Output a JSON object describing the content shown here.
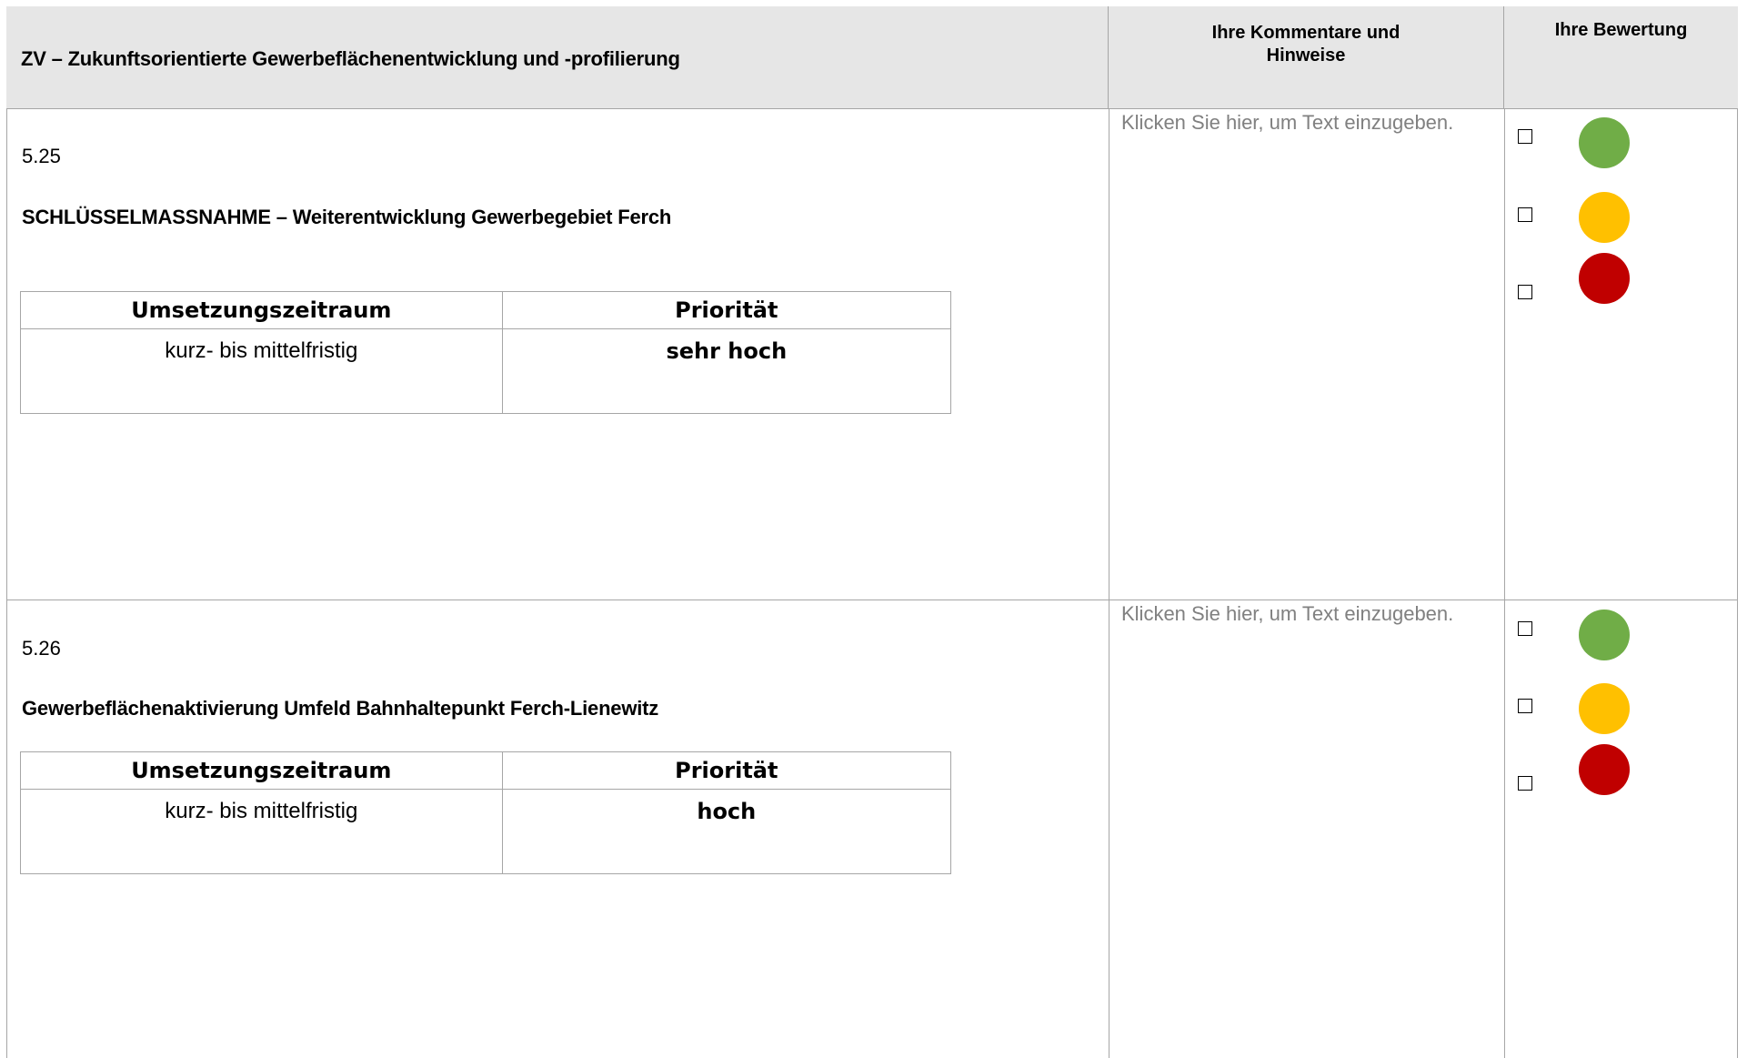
{
  "header": {
    "title": "ZV – Zukunftsorientierte Gewerbeflächenentwicklung und -profilierung",
    "comments_line1": "Ihre Kommentare und",
    "comments_line2": "Hinweise",
    "rating": "Ihre Bewertung"
  },
  "measures": [
    {
      "number": "5.25",
      "title": "SCHLÜSSELMASSNAHME – Weiterentwicklung Gewerbegebiet Ferch",
      "table_header": [
        "Umsetzungszeitraum",
        "Priorität"
      ],
      "timeframe": "kurz- bis mittelfristig",
      "priority": "sehr hoch",
      "comment_placeholder": "Klicken Sie hier, um Text einzugeben.",
      "rating_options": [
        {
          "color_name": "green",
          "color": "#70ad47",
          "checked": false
        },
        {
          "color_name": "yellow",
          "color": "#ffc000",
          "checked": false
        },
        {
          "color_name": "red",
          "color": "#c00000",
          "checked": false
        }
      ]
    },
    {
      "number": "5.26",
      "title": "Gewerbeflächenaktivierung Umfeld Bahnhaltepunkt Ferch-Lienewitz",
      "table_header": [
        "Umsetzungszeitraum",
        "Priorität"
      ],
      "timeframe": "kurz- bis mittelfristig",
      "priority": "hoch",
      "comment_placeholder": "Klicken Sie hier, um Text einzugeben.",
      "rating_options": [
        {
          "color_name": "green",
          "color": "#70ad47",
          "checked": false
        },
        {
          "color_name": "yellow",
          "color": "#ffc000",
          "checked": false
        },
        {
          "color_name": "red",
          "color": "#c00000",
          "checked": false
        }
      ]
    }
  ]
}
